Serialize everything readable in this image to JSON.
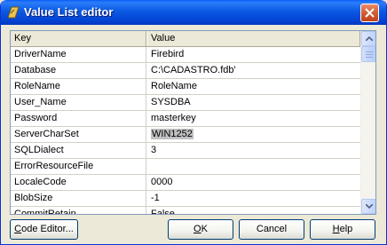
{
  "window": {
    "title": "Value List editor",
    "icon": "delphi-app-icon",
    "close_icon": "close-icon"
  },
  "grid": {
    "columns": [
      "Key",
      "Value"
    ],
    "rows": [
      {
        "key": "DriverName",
        "value": "Firebird"
      },
      {
        "key": "Database",
        "value": "C:\\CADASTRO.fdb'"
      },
      {
        "key": "RoleName",
        "value": "RoleName"
      },
      {
        "key": "User_Name",
        "value": "SYSDBA"
      },
      {
        "key": "Password",
        "value": "masterkey"
      },
      {
        "key": "ServerCharSet",
        "value": "WIN1252"
      },
      {
        "key": "SQLDialect",
        "value": "3"
      },
      {
        "key": "ErrorResourceFile",
        "value": ""
      },
      {
        "key": "LocaleCode",
        "value": "0000"
      },
      {
        "key": "BlobSize",
        "value": "-1"
      },
      {
        "key": "CommitRetain",
        "value": "False"
      }
    ],
    "selected_row_key": "ServerCharSet"
  },
  "buttons": {
    "code_editor": {
      "mnemonic": "C",
      "rest": "ode Editor..."
    },
    "ok": {
      "mnemonic": "O",
      "rest": "K"
    },
    "cancel": {
      "label": "Cancel"
    },
    "help": {
      "mnemonic": "H",
      "rest": "elp"
    }
  },
  "colors": {
    "titlebar": "#0b59e3",
    "close_button": "#d35c33",
    "selection": "#c0c0c0"
  }
}
